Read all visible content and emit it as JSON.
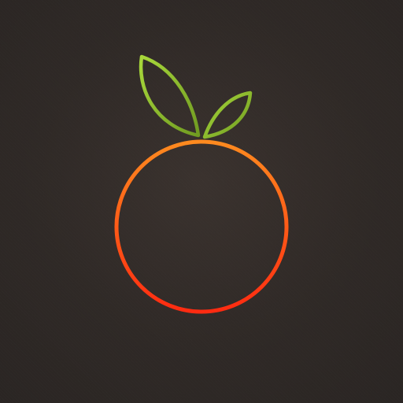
{
  "logo": {
    "icon": "orange-fruit-outline-icon",
    "leaf_icon": "leaf-outline-icon",
    "colors": {
      "background": "#2f2926",
      "fruit_top": "#ff8a1e",
      "fruit_bottom": "#ff2a10",
      "leaf_light": "#a8d83a",
      "leaf_dark": "#6f9a20"
    }
  }
}
